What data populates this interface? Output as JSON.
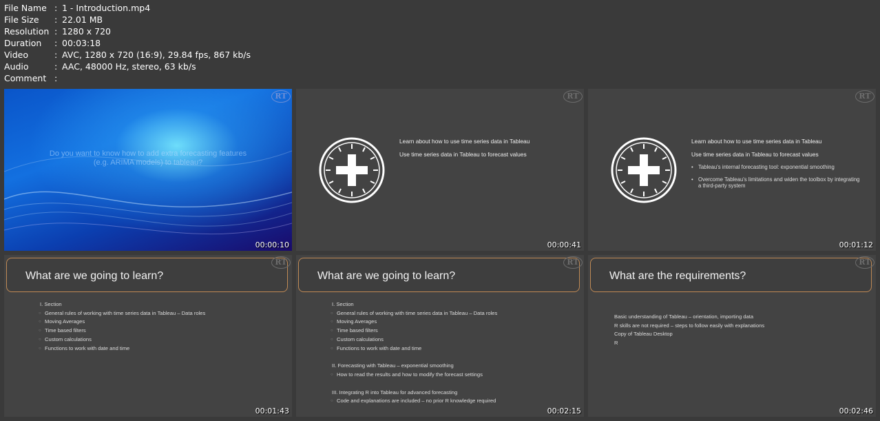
{
  "meta": [
    {
      "label": "File Name",
      "value": "1 - Introduction.mp4"
    },
    {
      "label": "File Size",
      "value": "22.01 MB"
    },
    {
      "label": "Resolution",
      "value": "1280 x 720"
    },
    {
      "label": "Duration",
      "value": "00:03:18"
    },
    {
      "label": "Video",
      "value": "AVC, 1280 x 720 (16:9), 29.84 fps, 867 kb/s"
    },
    {
      "label": "Audio",
      "value": "AAC, 48000 Hz, stereo, 63 kb/s"
    },
    {
      "label": "Comment",
      "value": ""
    }
  ],
  "logo_text": "RT",
  "thumbs": [
    {
      "timestamp": "00:00:10",
      "text_line1": "Do you want to know how to add extra forecasting features",
      "text_line2": "(e.g. ARIMA models) to tableau?"
    },
    {
      "timestamp": "00:00:41",
      "line1": "Learn about how to use time series data in Tableau",
      "line2": "Use time series data in Tableau to forecast values"
    },
    {
      "timestamp": "00:01:12",
      "line1": "Learn about how to use time series data in Tableau",
      "line2": "Use time series data in Tableau to forecast values",
      "bullet1": "Tableau's internal forecasting tool: exponential smoothing",
      "bullet2": "Overcome Tableau's limitations and widen the toolbox by integrating a third-party system"
    },
    {
      "timestamp": "00:01:43",
      "title": "What are we going to learn?"
    },
    {
      "timestamp": "00:02:15",
      "title": "What are we going to learn?"
    },
    {
      "timestamp": "00:02:46",
      "title": "What are the requirements?"
    }
  ],
  "agenda": {
    "section1": "I. Section",
    "items1": [
      "General rules of working with time series data in Tableau – Data roles",
      "Moving Averages",
      "Time based filters",
      "Custom calculations",
      "Functions to work with date and time"
    ],
    "section2": "II. Forecasting with Tableau – exponential smoothing",
    "items2": [
      "How to read the results and how to modify the forecast settings"
    ],
    "section3": "III. Integrating R into Tableau for advanced forecasting",
    "items3": [
      "Code and explanations are included – no prior R knowledge required"
    ]
  },
  "requirements": [
    "Basic understanding of Tableau – orientation, importing data",
    "R skills are not required – steps to follow easily with explanations",
    "Copy of Tableau Desktop",
    "R"
  ]
}
